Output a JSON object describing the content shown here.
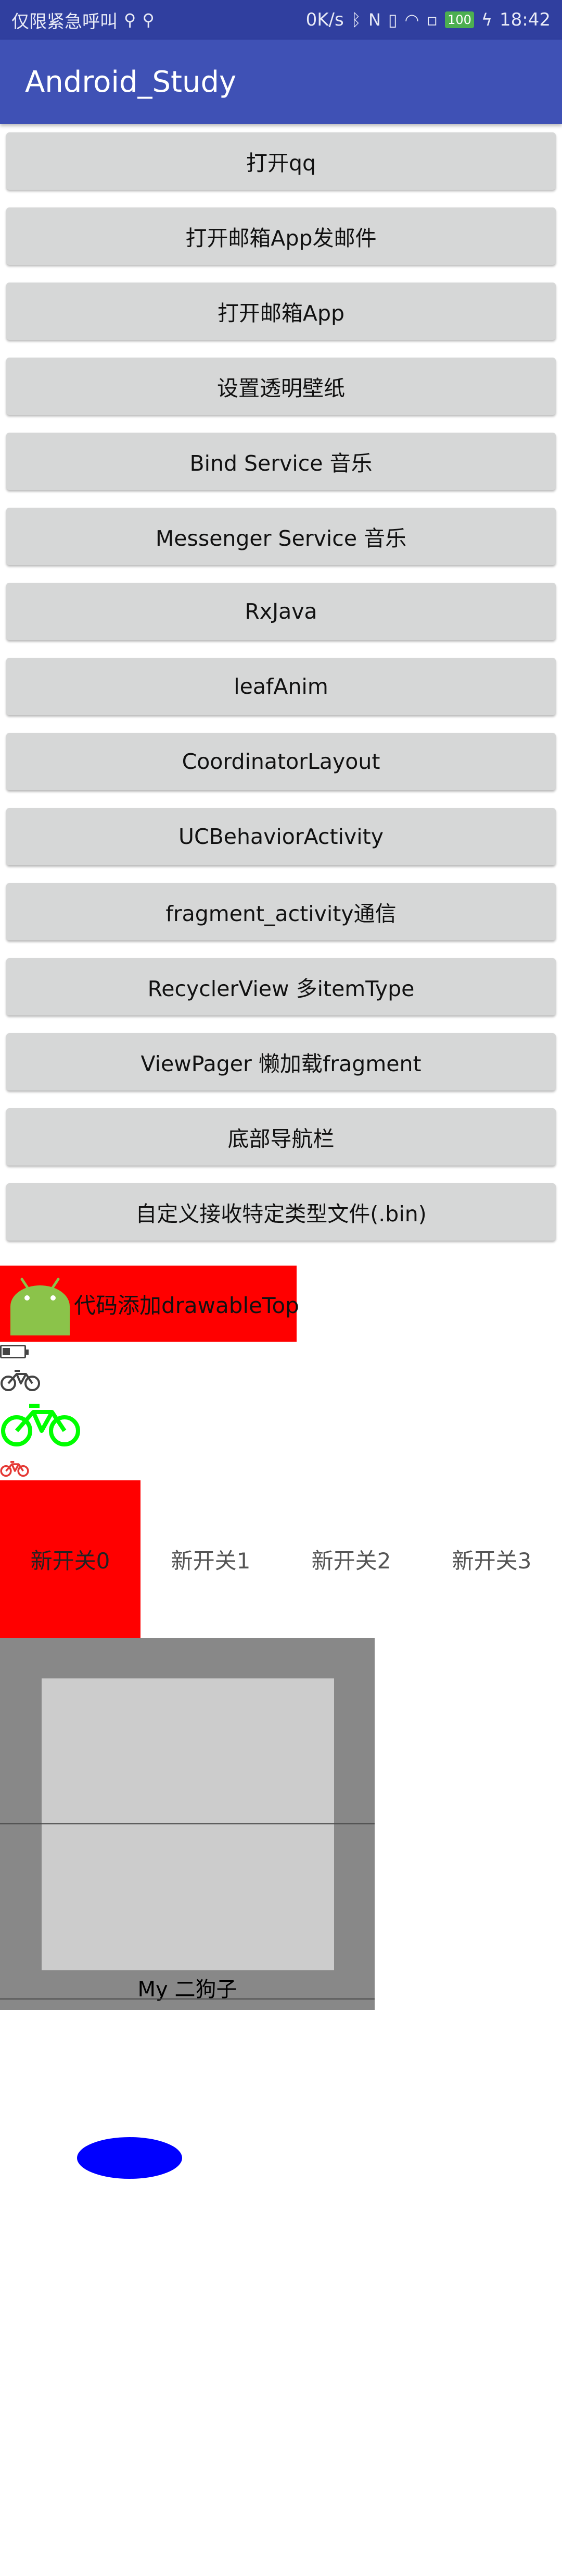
{
  "status_bar": {
    "carrier": "仅限紧急呼叫",
    "usb_icon": "usb-icon",
    "speed": "0K/s",
    "battery": "100",
    "time": "18:42"
  },
  "app": {
    "title": "Android_Study"
  },
  "buttons": [
    {
      "label": "打开qq"
    },
    {
      "label": "打开邮箱App发邮件"
    },
    {
      "label": "打开邮箱App"
    },
    {
      "label": "设置透明壁纸"
    },
    {
      "label": "Bind Service 音乐"
    },
    {
      "label": "Messenger Service 音乐"
    },
    {
      "label": "RxJava"
    },
    {
      "label": "leafAnim"
    },
    {
      "label": "CoordinatorLayout"
    },
    {
      "label": "UCBehaviorActivity"
    },
    {
      "label": "fragment_activity通信"
    },
    {
      "label": "RecyclerView 多itemType"
    },
    {
      "label": "ViewPager 懒加载fragment"
    },
    {
      "label": "底部导航栏"
    },
    {
      "label": "自定义接收特定类型文件(.bin)"
    }
  ],
  "drawable_text": {
    "label": "代码添加drawableTop"
  },
  "tabs": [
    {
      "label": "新开关0"
    },
    {
      "label": "新开关1"
    },
    {
      "label": "新开关2"
    },
    {
      "label": "新开关3"
    }
  ],
  "grey_box": {
    "caption": "My 二狗子"
  },
  "colors": {
    "status_bar": "#303F9F",
    "app_bar": "#3F51B5",
    "button": "#D6D7D7",
    "red": "#FF0000",
    "bike_green": "#00FF00",
    "bike_red": "#E53935",
    "oval": "#0000FF"
  }
}
